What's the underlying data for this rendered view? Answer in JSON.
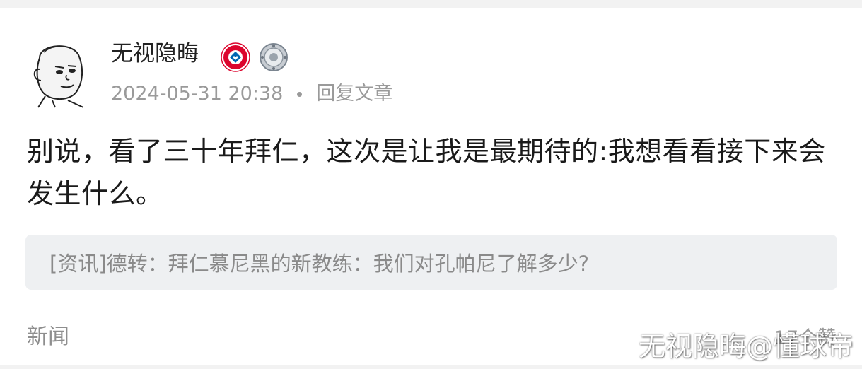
{
  "post": {
    "author_name": "无视隐晦",
    "badges": [
      "fc-bayern-badge",
      "trophy-plate-badge"
    ],
    "timestamp": "2024-05-31 20:38",
    "reply_label": "回复文章",
    "content": "别说，看了三十年拜仁，这次是让我是最期待的:我想看看接下来会发生什么。",
    "quoted_article": "[资讯]德转：拜仁慕尼黑的新教练：我们对孔帕尼了解多少?",
    "category": "新闻",
    "likes": "17个赞"
  },
  "watermark": "无视隐晦@懂球帝",
  "colors": {
    "background": "#f2f2f2",
    "card": "#ffffff",
    "text_primary": "#1a1a1a",
    "text_secondary": "#9a9a9a",
    "quote_bg": "#eef0f2",
    "bayern_red": "#dc052d",
    "bayern_blue": "#0066b2"
  }
}
